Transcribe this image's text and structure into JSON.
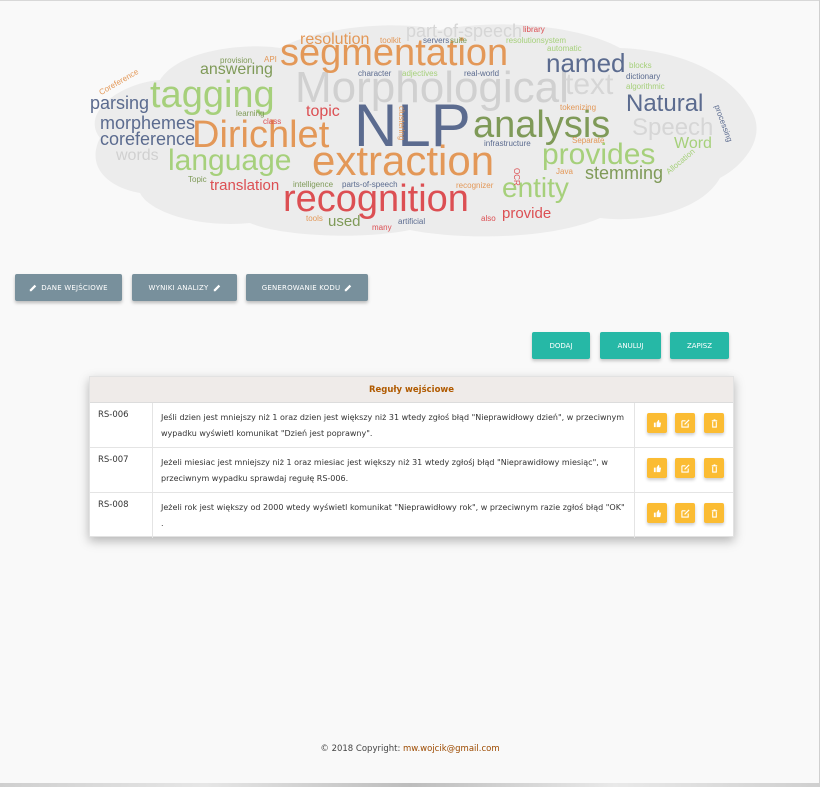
{
  "word_cloud": {
    "words": [
      {
        "text": "NLP",
        "color": "#5b6b8f"
      },
      {
        "text": "Morphological",
        "color": "#d0d0d0"
      },
      {
        "text": "segmentation",
        "color": "#e39858"
      },
      {
        "text": "analysis",
        "color": "#7f9a58"
      },
      {
        "text": "extraction",
        "color": "#e39858"
      },
      {
        "text": "recognition",
        "color": "#dc4f53"
      },
      {
        "text": "Dirichlet",
        "color": "#e39858"
      },
      {
        "text": "tagging",
        "color": "#a6d07b"
      },
      {
        "text": "language",
        "color": "#a6d07b"
      },
      {
        "text": "provides",
        "color": "#a6d07b"
      },
      {
        "text": "entity",
        "color": "#a6d07b"
      },
      {
        "text": "named",
        "color": "#5b6b8f"
      },
      {
        "text": "Natural",
        "color": "#5b6b8f"
      },
      {
        "text": "Speech",
        "color": "#d6d6d6"
      },
      {
        "text": "text",
        "color": "#d6d6d6"
      },
      {
        "text": "stemming",
        "color": "#7f9a58"
      },
      {
        "text": "Word",
        "color": "#a6d07b"
      },
      {
        "text": "parsing",
        "color": "#5b6b8f"
      },
      {
        "text": "morphemes",
        "color": "#5b6b8f"
      },
      {
        "text": "coreference",
        "color": "#5b6b8f"
      },
      {
        "text": "words",
        "color": "#d0d0d0"
      },
      {
        "text": "answering",
        "color": "#7f9a58"
      },
      {
        "text": "resolution",
        "color": "#e39858"
      },
      {
        "text": "part-of-speech",
        "color": "#d6d6d6"
      },
      {
        "text": "translation",
        "color": "#dc4f53"
      },
      {
        "text": "topic",
        "color": "#dc4f53"
      },
      {
        "text": "provide",
        "color": "#dc4f53"
      },
      {
        "text": "used",
        "color": "#7f9a58"
      },
      {
        "text": "Topic",
        "color": "#7f9a58"
      },
      {
        "text": "intelligence",
        "color": "#7f9a58"
      },
      {
        "text": "parts-of-speech",
        "color": "#5b6b8f"
      },
      {
        "text": "recognizer",
        "color": "#e39858"
      },
      {
        "text": "Java",
        "color": "#e39858"
      },
      {
        "text": "Allocation",
        "color": "#a6d07b"
      },
      {
        "text": "tools",
        "color": "#e39858"
      },
      {
        "text": "many",
        "color": "#dc4f53"
      },
      {
        "text": "artificial",
        "color": "#5b6b8f"
      },
      {
        "text": "also",
        "color": "#dc4f53"
      },
      {
        "text": "infrastructure",
        "color": "#5b6b8f"
      },
      {
        "text": "OCR",
        "color": "#dc4f53"
      },
      {
        "text": "Separate",
        "color": "#e39858"
      },
      {
        "text": "tokenizing",
        "color": "#e39858"
      },
      {
        "text": "dictionary",
        "color": "#5b6b8f"
      },
      {
        "text": "algorithmic",
        "color": "#a6d07b"
      },
      {
        "text": "blocks",
        "color": "#a6d07b"
      },
      {
        "text": "library",
        "color": "#dc4f53"
      },
      {
        "text": "resolutionsystem",
        "color": "#a6d07b"
      },
      {
        "text": "automatic",
        "color": "#a6d07b"
      },
      {
        "text": "real-world",
        "color": "#5b6b8f"
      },
      {
        "text": "character",
        "color": "#5b6b8f"
      },
      {
        "text": "adjectives",
        "color": "#a6d07b"
      },
      {
        "text": "toolkit",
        "color": "#e39858"
      },
      {
        "text": "servers",
        "color": "#5b6b8f"
      },
      {
        "text": "suite",
        "color": "#7f9a58"
      },
      {
        "text": "provision",
        "color": "#7f9a58"
      },
      {
        "text": "API",
        "color": "#e39858"
      },
      {
        "text": "learning",
        "color": "#7f9a58"
      },
      {
        "text": "class",
        "color": "#dc4f53"
      },
      {
        "text": "clustering",
        "color": "#e39858"
      },
      {
        "text": "Coreference",
        "color": "#e39858"
      },
      {
        "text": "processing",
        "color": "#5b6b8f"
      }
    ]
  },
  "nav": {
    "input_label": "DANE WEJŚCIOWE",
    "results_label": "WYNIKI ANALIZY",
    "codegen_label": "GENEROWANIE KODU"
  },
  "actions": {
    "add_label": "DODAJ",
    "cancel_label": "ANULUJ",
    "save_label": "ZAPISZ"
  },
  "rules_table": {
    "title": "Reguły wejściowe",
    "rows": [
      {
        "id": "RS-006",
        "text": "Jeśli dzien jest mniejszy niż 1 oraz dzien jest większy niż 31 wtedy zgłoś błąd \"Nieprawidłowy dzień\", w przeciwnym wypadku wyświetl komunikat \"Dzień jest poprawny\"."
      },
      {
        "id": "RS-007",
        "text": "Jeżeli miesiac jest mniejszy niż 1 oraz miesiac jest większy niż 31 wtedy zgłośj błąd \"Nieprawidłowy miesiąc\", w przeciwnym wypadku sprawdaj regułę RS-006."
      },
      {
        "id": "RS-008",
        "text": "Jeżeli rok jest większy od 2000 wtedy wyświetl komunikat \"Nieprawidłowy rok\", w przeciwnym razie zgłoś błąd \"OK\" ."
      }
    ]
  },
  "footer": {
    "copyright": "© 2018 Copyright:",
    "email": "mw.wojcik@gmail.com"
  },
  "colors": {
    "nav_button": "#78909c",
    "action_button": "#26b8a6",
    "row_icon_button": "#fbbc33",
    "table_title": "#b05a00"
  }
}
